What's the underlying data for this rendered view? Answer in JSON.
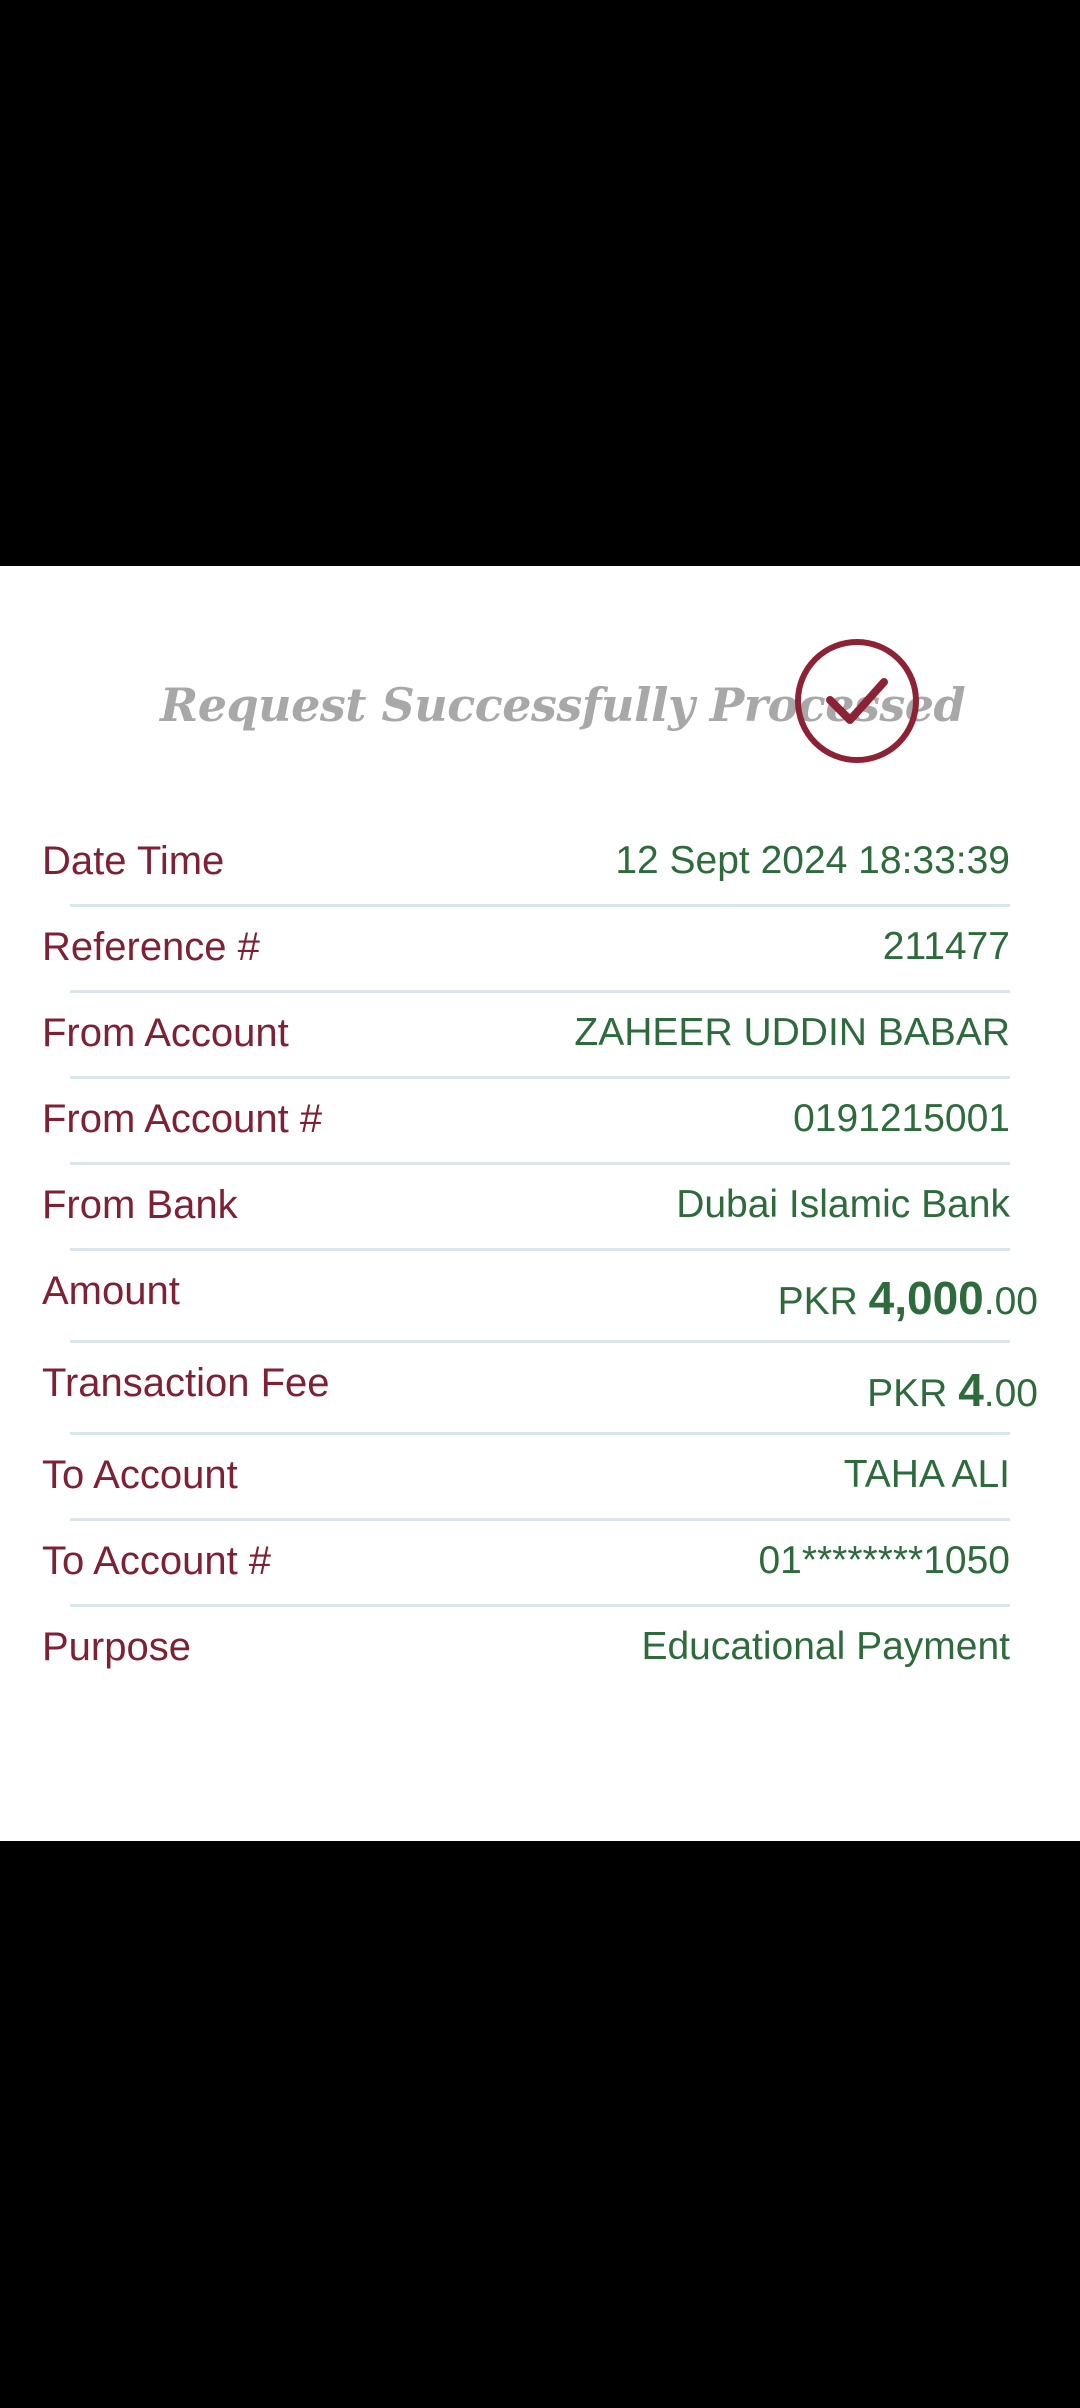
{
  "colors": {
    "label": "#7f2135",
    "value": "#2e6b3c",
    "title": "#a8a8a8",
    "check": "#8e2235",
    "divider": "#dbe6ec"
  },
  "header": {
    "title": "Request Successfully Processed",
    "icon": "check-circle-icon"
  },
  "details": {
    "date_time": {
      "label": "Date Time",
      "value": "12 Sept 2024 18:33:39"
    },
    "reference": {
      "label": "Reference #",
      "value": "211477"
    },
    "from_account": {
      "label": "From Account",
      "value": "ZAHEER UDDIN BABAR"
    },
    "from_account_number": {
      "label": "From Account #",
      "value": "0191215001"
    },
    "from_bank": {
      "label": "From Bank",
      "value": "Dubai Islamic Bank"
    },
    "amount": {
      "label": "Amount",
      "currency": "PKR",
      "whole": "4,000",
      "fraction": ".00"
    },
    "transaction_fee": {
      "label": "Transaction Fee",
      "currency": "PKR",
      "whole": "4",
      "fraction": ".00"
    },
    "to_account": {
      "label": "To Account",
      "value": "TAHA ALI"
    },
    "to_account_number": {
      "label": "To Account #",
      "value": "01********1050"
    },
    "purpose": {
      "label": "Purpose",
      "value": "Educational Payment"
    }
  }
}
